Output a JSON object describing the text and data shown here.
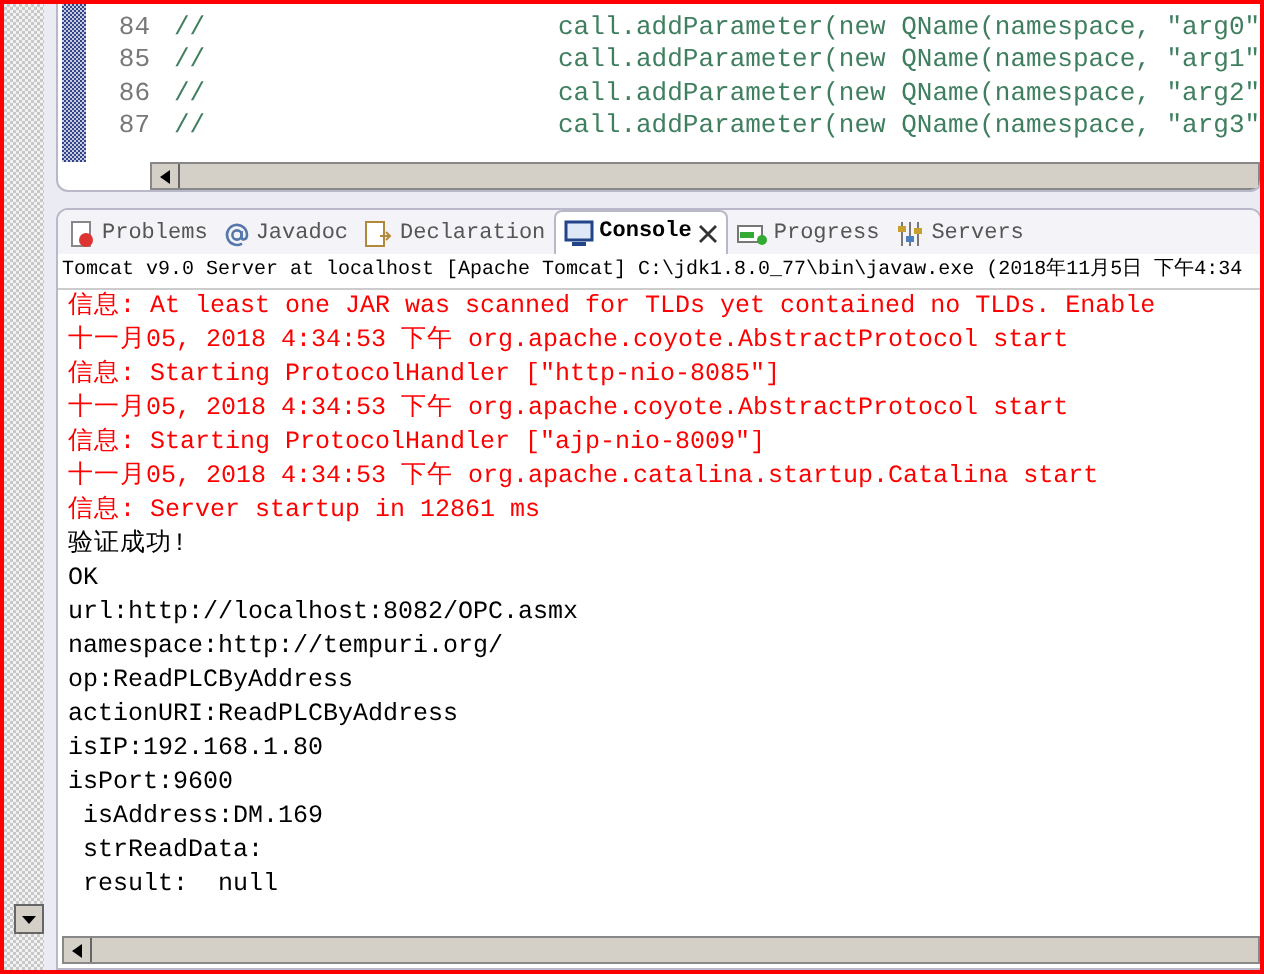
{
  "editor": {
    "lines": [
      {
        "number": "84",
        "comment": "//",
        "code": "call.addParameter(new QName(namespace, \"arg0\""
      },
      {
        "number": "85",
        "comment": "//",
        "code": "call.addParameter(new QName(namespace, \"arg1\""
      },
      {
        "number": "86",
        "comment": "//",
        "code": "call.addParameter(new QName(namespace, \"arg2\""
      },
      {
        "number": "87",
        "comment": "//",
        "code": "call.addParameter(new QName(namespace, \"arg3\""
      }
    ]
  },
  "tabs": [
    {
      "label": "Problems",
      "kind": "problems",
      "selected": false
    },
    {
      "label": "Javadoc",
      "kind": "javadoc",
      "selected": false
    },
    {
      "label": "Declaration",
      "kind": "declaration",
      "selected": false
    },
    {
      "label": "Console",
      "kind": "console",
      "selected": true
    },
    {
      "label": "Progress",
      "kind": "progress",
      "selected": false
    },
    {
      "label": "Servers",
      "kind": "servers",
      "selected": false
    }
  ],
  "console": {
    "header": "Tomcat v9.0 Server at localhost [Apache Tomcat] C:\\jdk1.8.0_77\\bin\\javaw.exe (2018年11月5日 下午4:34",
    "lines": [
      {
        "kind": "error",
        "text": "信息: At least one JAR was scanned for TLDs yet contained no TLDs. Enable"
      },
      {
        "kind": "error",
        "text": "十一月05, 2018 4:34:53 下午 org.apache.coyote.AbstractProtocol start"
      },
      {
        "kind": "error",
        "text": "信息: Starting ProtocolHandler [\"http-nio-8085\"]"
      },
      {
        "kind": "error",
        "text": "十一月05, 2018 4:34:53 下午 org.apache.coyote.AbstractProtocol start"
      },
      {
        "kind": "error",
        "text": "信息: Starting ProtocolHandler [\"ajp-nio-8009\"]"
      },
      {
        "kind": "error",
        "text": "十一月05, 2018 4:34:53 下午 org.apache.catalina.startup.Catalina start"
      },
      {
        "kind": "error",
        "text": "信息: Server startup in 12861 ms"
      },
      {
        "kind": "output",
        "text": "验证成功!"
      },
      {
        "kind": "output",
        "text": "OK"
      },
      {
        "kind": "output",
        "text": "url:http://localhost:8082/OPC.asmx"
      },
      {
        "kind": "output",
        "text": "namespace:http://tempuri.org/"
      },
      {
        "kind": "output",
        "text": "op:ReadPLCByAddress"
      },
      {
        "kind": "output",
        "text": "actionURI:ReadPLCByAddress"
      },
      {
        "kind": "output",
        "text": "isIP:192.168.1.80"
      },
      {
        "kind": "output",
        "text": "isPort:9600"
      },
      {
        "kind": "output",
        "text": " isAddress:DM.169"
      },
      {
        "kind": "output",
        "text": " strReadData:"
      },
      {
        "kind": "output",
        "text": " result:  null"
      }
    ]
  }
}
